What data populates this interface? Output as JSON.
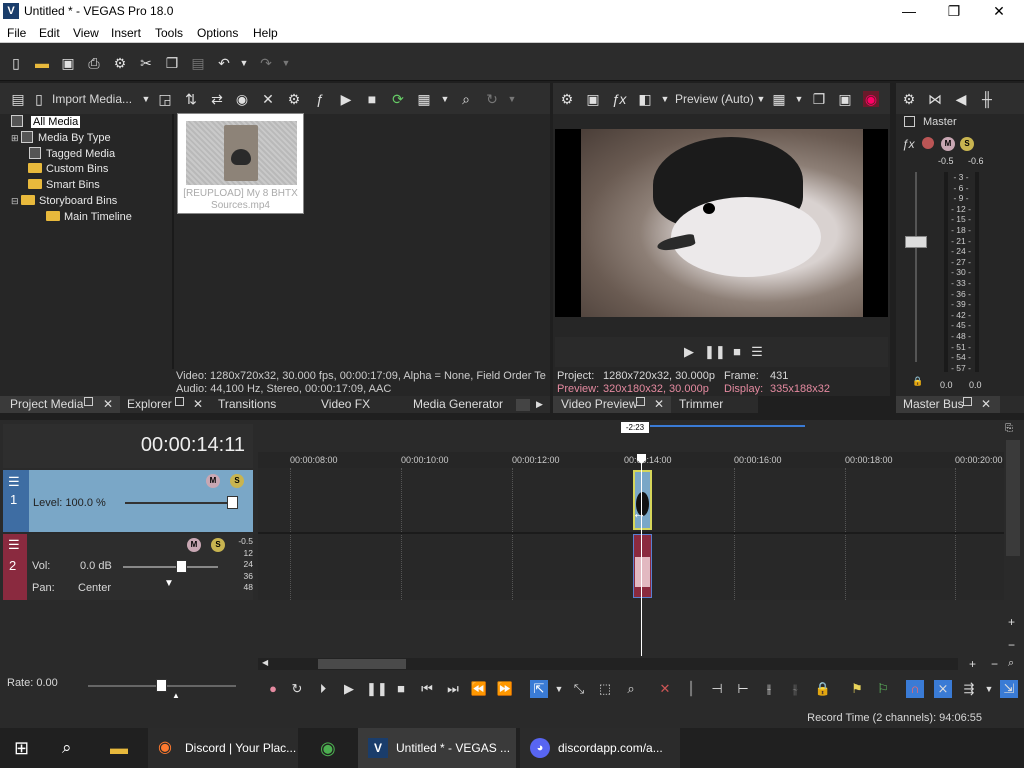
{
  "window": {
    "title": "Untitled * - VEGAS Pro 18.0",
    "logo": "V"
  },
  "menu": [
    "File",
    "Edit",
    "View",
    "Insert",
    "Tools",
    "Options",
    "Help"
  ],
  "project_media": {
    "toolbar_label": "Import Media...",
    "tree": [
      "All Media",
      "Media By Type",
      "Tagged Media",
      "Custom Bins",
      "Smart Bins",
      "Storyboard Bins",
      "Main Timeline"
    ],
    "thumb_label": "[REUPLOAD] My 8 BHTX Sources.mp4",
    "info_video": "Video: 1280x720x32, 30.000 fps, 00:00:17:09, Alpha = None, Field Order Te",
    "info_audio": "Audio: 44,100 Hz, Stereo, 00:00:17:09, AAC"
  },
  "tabs_left": [
    "Project Media",
    "Explorer",
    "Transitions",
    "Video FX",
    "Media Generator"
  ],
  "preview": {
    "mode": "Preview (Auto)",
    "project_label": "Project:",
    "project_val": "1280x720x32, 30.000p",
    "preview_label": "Preview:",
    "preview_val": "320x180x32, 30.000p",
    "frame_label": "Frame:",
    "frame_val": "431",
    "display_label": "Display:",
    "display_val": "335x188x32",
    "tab": "Video Preview",
    "tab2": "Trimmer"
  },
  "master": {
    "label": "Master",
    "tab": "Master Bus",
    "peak_l": "-0.5",
    "peak_r": "-0.6",
    "scale": [
      "3",
      "6",
      "9",
      "12",
      "15",
      "18",
      "21",
      "24",
      "27",
      "30",
      "33",
      "36",
      "39",
      "42",
      "45",
      "48",
      "51",
      "54",
      "57"
    ],
    "bottom_l": "0.0",
    "bottom_r": "0.0"
  },
  "timeline": {
    "time": "00:00:14:11",
    "loop_marker": "-2:23",
    "ruler": [
      "00:00:08:00",
      "00:00:10:00",
      "00:00:12:00",
      "00:00:14:00",
      "00:00:16:00",
      "00:00:18:00",
      "00:00:20:00"
    ],
    "track1": {
      "num": "1",
      "level": "Level: 100.0 %"
    },
    "track2": {
      "num": "2",
      "vol_label": "Vol:",
      "vol_val": "0.0 dB",
      "pan_label": "Pan:",
      "pan_val": "Center",
      "scale": [
        "-0.5",
        "12",
        "24",
        "36",
        "48"
      ]
    },
    "rate": "Rate: 0.00"
  },
  "status": "Record Time (2 channels): 94:06:55",
  "taskbar": {
    "items": [
      "Discord | Your Plac...",
      "Untitled * - VEGAS ...",
      "discordapp.com/a..."
    ]
  },
  "colors": {
    "accent": "#3a7bd5",
    "track1": "#7aa7c7",
    "track2": "#8a2a3f",
    "folder": "#e8b93c"
  }
}
